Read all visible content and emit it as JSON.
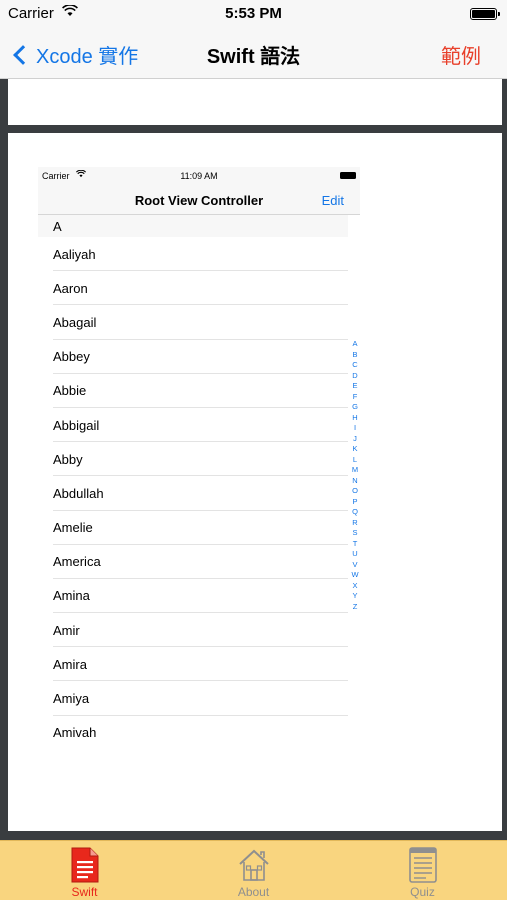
{
  "status_bar": {
    "carrier": "Carrier",
    "time": "5:53 PM"
  },
  "nav": {
    "back_label": "Xcode 實作",
    "title": "Swift 語法",
    "right_label": "範例"
  },
  "inner": {
    "status_carrier": "Carrier",
    "status_time": "11:09 AM",
    "nav_title": "Root View Controller",
    "edit_label": "Edit",
    "section_header": "A",
    "rows": [
      "Aaliyah",
      "Aaron",
      "Abagail",
      "Abbey",
      "Abbie",
      "Abbigail",
      "Abby",
      "Abdullah",
      "Amelie",
      "America",
      "Amina",
      "Amir",
      "Amira",
      "Amiya",
      "Amivah"
    ],
    "index_letters": [
      "A",
      "B",
      "C",
      "D",
      "E",
      "F",
      "G",
      "H",
      "I",
      "J",
      "K",
      "L",
      "M",
      "N",
      "O",
      "P",
      "Q",
      "R",
      "S",
      "T",
      "U",
      "V",
      "W",
      "X",
      "Y",
      "Z"
    ]
  },
  "tabs": [
    {
      "label": "Swift",
      "icon": "document-icon",
      "active": true,
      "color": "#e8281c"
    },
    {
      "label": "About",
      "icon": "house-icon",
      "active": false,
      "color": "#8f8f8f"
    },
    {
      "label": "Quiz",
      "icon": "notes-icon",
      "active": false,
      "color": "#8f8f8f"
    }
  ],
  "colors": {
    "accent_blue": "#1476e6",
    "accent_red": "#e8402b",
    "tab_bar": "#f9d57f"
  }
}
